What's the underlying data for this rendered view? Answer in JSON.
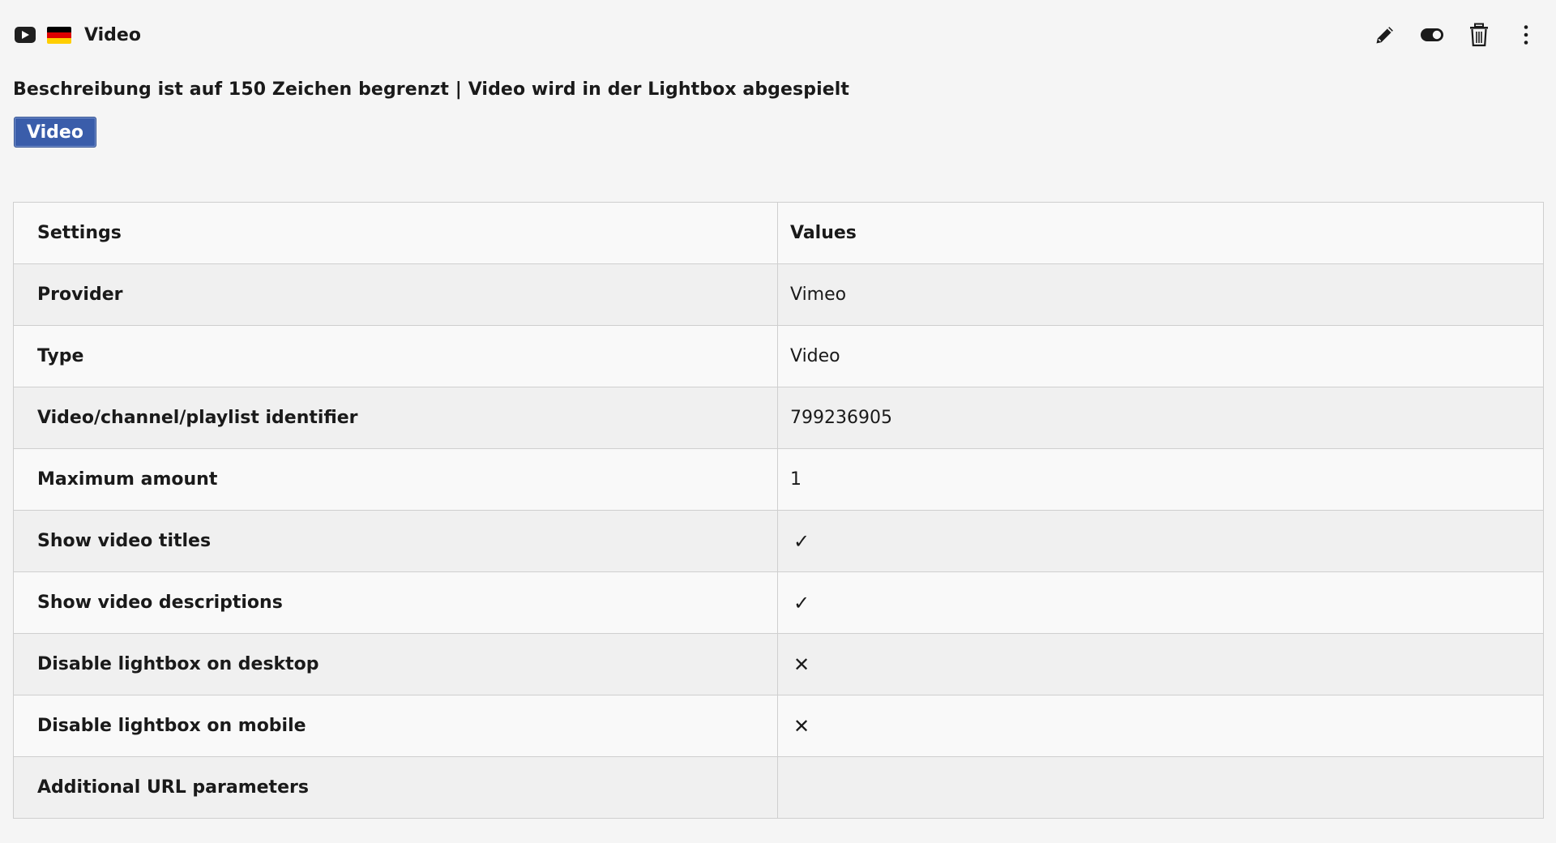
{
  "header": {
    "provider_icon": "youtube-play-icon",
    "language_flag": "german-flag-icon",
    "title": "Video"
  },
  "toolbar": {
    "edit_icon": "pencil-icon",
    "toggle_icon": "toggle-icon",
    "delete_icon": "trash-icon",
    "more_icon": "more-vertical-icon"
  },
  "description": "Beschreibung ist auf 150 Zeichen begrenzt | Video wird in der Lightbox abgespielt",
  "badge": {
    "label": "Video",
    "color": "#3a5daa"
  },
  "table": {
    "headers": [
      "Settings",
      "Values"
    ],
    "rows": [
      {
        "setting": "Provider",
        "value": "Vimeo"
      },
      {
        "setting": "Type",
        "value": "Video"
      },
      {
        "setting": "Video/channel/playlist identifier",
        "value": "799236905"
      },
      {
        "setting": "Maximum amount",
        "value": "1"
      },
      {
        "setting": "Show video titles",
        "value": "✓"
      },
      {
        "setting": "Show video descriptions",
        "value": "✓"
      },
      {
        "setting": "Disable lightbox on desktop",
        "value": "✕"
      },
      {
        "setting": "Disable lightbox on mobile",
        "value": "✕"
      },
      {
        "setting": "Additional URL parameters",
        "value": ""
      }
    ]
  }
}
